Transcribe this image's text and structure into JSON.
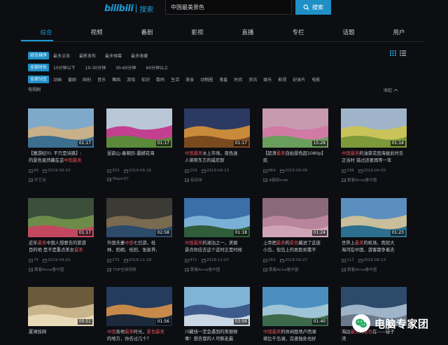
{
  "header": {
    "logo": "bilibili",
    "logo_suffix": "搜索",
    "search_value": "中国最美景色",
    "search_button": "搜索"
  },
  "tabs": [
    "综合",
    "视频",
    "番剧",
    "影视",
    "直播",
    "专栏",
    "话题",
    "用户"
  ],
  "filters": {
    "sort": {
      "active": "综合排序",
      "options": [
        "最多点击",
        "最新发布",
        "最多弹幕",
        "最多收藏"
      ]
    },
    "duration": {
      "active": "全部时长",
      "options": [
        "10分钟以下",
        "10-30分钟",
        "30-60分钟",
        "60分钟以上"
      ]
    },
    "zone": {
      "active": "全部分区",
      "options": [
        "动画",
        "番剧",
        "国创",
        "音乐",
        "舞蹈",
        "游戏",
        "知识",
        "数码",
        "生活",
        "美食",
        "动物圈",
        "鬼畜",
        "时尚",
        "资讯",
        "娱乐",
        "影视",
        "纪录片",
        "电影"
      ],
      "extra": "电视剧"
    },
    "collapse_label": "收起"
  },
  "cards": [
    {
      "duration": "01:17",
      "t1": "【魔游纪川: 不只是诗路】: ",
      "t1hl": "",
      "t2hl": "中国最美",
      "t2": "的景色竟然藏在这",
      "plays": "99",
      "date": "2019-06-03",
      "uploader": "环艺派"
    },
    {
      "duration": "01:17",
      "t1": "昆嵛山-秦朝历-震撼花海",
      "t1hl": "",
      "t2hl": "",
      "t2": "",
      "plays": "303",
      "date": "2019-04-26",
      "uploader": "MajorZY"
    },
    {
      "duration": "01:17",
      "t1": "",
      "t1hl": "中国最美",
      "t1b": "水上市场，夜色迷",
      "t2hl": "",
      "t2": "人堪称东方的威尼斯",
      "plays": "259",
      "date": "2019-04-23",
      "uploader": "有玩味"
    },
    {
      "duration": "15:28",
      "t1": "【超清",
      "t1hl": "最美",
      "t1b": "自拍景色超1080p】航",
      "t2": "拍",
      "t2hl": "中国最美",
      "t2b": "的一处花开美景 四月最",
      "plays": "864",
      "date": "2019-04-09",
      "uploader": "A骊部erde"
    },
    {
      "duration": "01:14",
      "t1": "",
      "t1hl": "中国最美",
      "t1b": "的油菜花田海拔此时去",
      "t2hl": "",
      "t2": "正当时 错过还要再等一年",
      "plays": "336",
      "date": "2019-04-05",
      "uploader": "跟着Anna看中国"
    },
    {
      "duration": "01:17",
      "t1": "近年",
      "t1hl": "最美",
      "t1b": "中国人想要去的旅游",
      "t2hl": "",
      "t2": "目的地 ",
      "t2b": "是不是重点美女",
      "t2hl2": "最美",
      "plays": "75",
      "date": "2019-04-02",
      "uploader": "跟着Anna看中国"
    },
    {
      "duration": "02:58",
      "t1": "外国夫妻",
      "t1hl": "中国",
      "t1b": "七日游，桂",
      "t2hl": "",
      "t2": "林、阳朔、桂田、张家界、",
      "plays": "270",
      "date": "2018-11-28",
      "uploader": "TOP全球视频"
    },
    {
      "duration": "01:18",
      "t1": "",
      "t1hl": "中国最美",
      "t1b": "的湖泊之一，美丽",
      "t2hl": "",
      "t2": "景点你应去这个这时正是时候",
      "plays": "471",
      "date": "2018-11-07",
      "uploader": "跟着Anna看中国"
    },
    {
      "duration": "01:24",
      "t1": "上帝把",
      "t1hl": "最美",
      "t1b": "的",
      "t1hl2": "景色",
      "t1c": "藏进了这座",
      "t2hl": "",
      "t2": "小岛，但岛上的居民却靠不",
      "plays": "263",
      "date": "2018-09-27",
      "uploader": "跟着Anna看中国"
    },
    {
      "duration": "01:23",
      "t1": "世界上",
      "t1hl": "最美",
      "t1b": "的机场，而就大",
      "t2hl": "",
      "t2": "海河在中国，游客都争着去",
      "plays": "117",
      "date": "2018-08-23",
      "uploader": "跟着Anna看中国"
    },
    {
      "duration": "00:51",
      "t1": "厦滩技网",
      "t1hl": "",
      "t2hl": "",
      "t2": "",
      "plays": "",
      "date": "",
      "uploader": ""
    },
    {
      "duration": "01:56",
      "t1": "",
      "t1hl": "中国",
      "t1b": "各地",
      "t1hl2": "最美",
      "t1c": "时光，",
      "t1hl3": "景色最美",
      "t2hl": "",
      "t2": "的地方，你去过几个？",
      "plays": "",
      "date": "",
      "uploader": ""
    },
    {
      "duration": "03:04",
      "t1": "川藏线一定会遇到的美丽故",
      "t1hl": "",
      "t2hl": "",
      "t2": "事！想去我的人可断走最",
      "plays": "",
      "date": "",
      "uploader": ""
    },
    {
      "duration": "01:40",
      "t1": "",
      "t1hl": "中国最美",
      "t1b": "的休闲胜地卢西湖",
      "t2hl": "",
      "t2": "堪比千岛湖，完善独处也好",
      "plays": "",
      "date": "",
      "uploader": ""
    },
    {
      "duration": "",
      "t1": "海边",
      "t1hl": "最美",
      "t1b": "的",
      "t1hl2": "景色",
      "t1c": "在——疑子",
      "t2hl": "",
      "t2": "湾",
      "plays": "",
      "date": "",
      "uploader": ""
    }
  ],
  "watermark": {
    "text": "电脑专家团"
  },
  "colors": {
    "accent": "#1d9bd6",
    "highlight": "#e2515c",
    "bg": "#0c0e12"
  }
}
